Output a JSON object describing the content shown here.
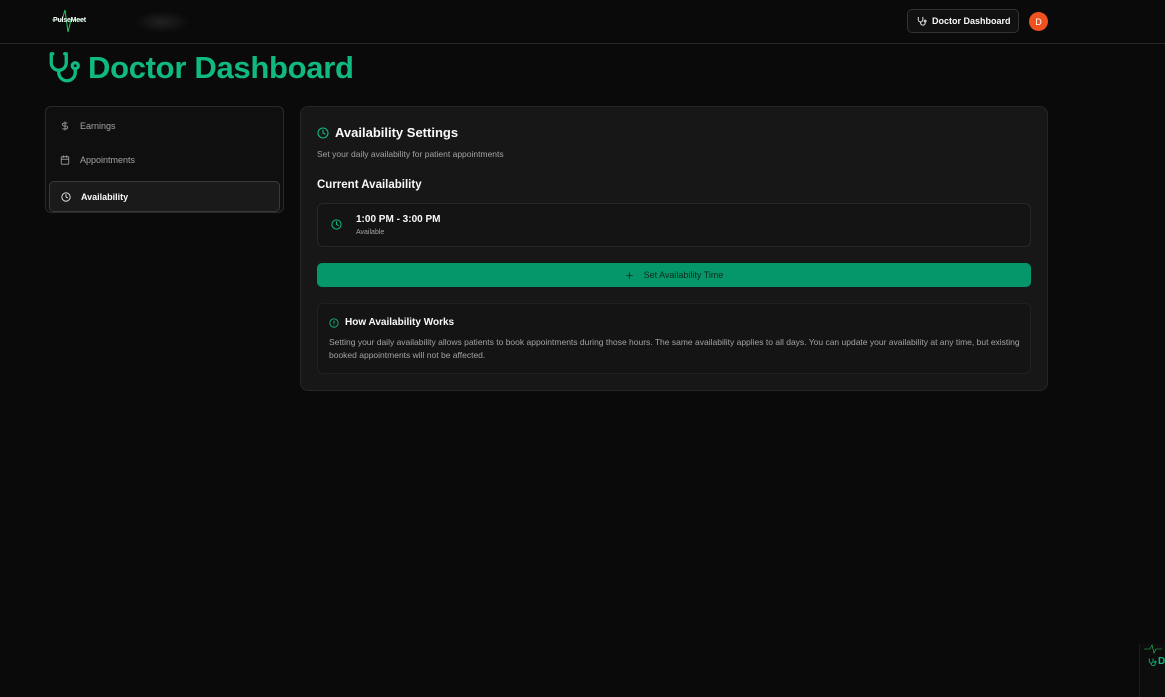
{
  "header": {
    "logo_text": "PulseMeet",
    "dashboard_button_label": "Doctor Dashboard",
    "avatar_initial": "D"
  },
  "page": {
    "title": "Doctor Dashboard"
  },
  "sidebar": {
    "items": [
      {
        "label": "Earnings",
        "icon": "dollar-icon"
      },
      {
        "label": "Appointments",
        "icon": "calendar-icon"
      },
      {
        "label": "Availability",
        "icon": "clock-icon",
        "active": true
      }
    ]
  },
  "availability": {
    "title": "Availability Settings",
    "subtitle": "Set your daily availability for patient appointments",
    "current_heading": "Current Availability",
    "slot": {
      "time": "1:00 PM - 3:00 PM",
      "status": "Available"
    },
    "set_button_label": "Set Availability Time",
    "info": {
      "title": "How Availability Works",
      "body": "Setting your daily availability allows patients to book appointments during those hours. The same availability applies to all days. You can update your availability at any time, but existing booked appointments will not be affected."
    }
  },
  "thumbnail": {
    "letter": "D"
  },
  "colors": {
    "accent": "#10b981",
    "button": "#059669",
    "avatar": "#f0521f",
    "background": "#0a0a0a",
    "card": "#171717"
  }
}
